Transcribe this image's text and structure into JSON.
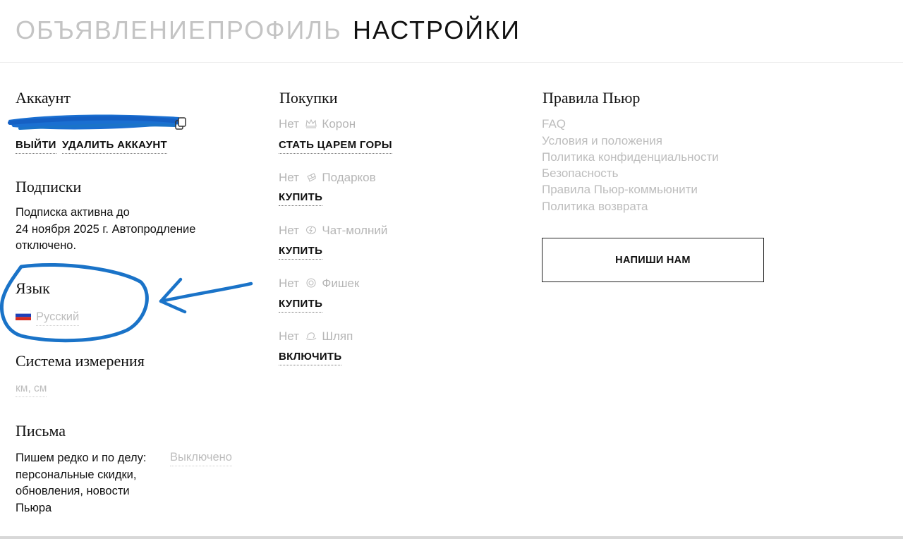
{
  "tabs": [
    {
      "label": "ОБЪЯВЛЕНИЕ",
      "active": false
    },
    {
      "label": "ПРОФИЛЬ",
      "active": false
    },
    {
      "label": "НАСТРОЙКИ",
      "active": true
    }
  ],
  "account": {
    "heading": "Аккаунт",
    "logout_label": "ВЫЙТИ",
    "delete_label": "УДАЛИТЬ АККАУНТ"
  },
  "subscriptions": {
    "heading": "Подписки",
    "status_lines": [
      "Подписка активна до",
      "24 ноября 2025 г. Автопродление",
      "отключено."
    ]
  },
  "language": {
    "heading": "Язык",
    "flag_icon": "russia-flag-icon",
    "value": "Русский"
  },
  "measurement": {
    "heading": "Система измерения",
    "value": "км, см"
  },
  "emails": {
    "heading": "Письма",
    "description_lines": [
      "Пишем редко и по делу:",
      "персональные скидки,",
      "обновления, новости",
      "Пьюра"
    ],
    "toggle_value": "Выключено"
  },
  "purchases": {
    "heading": "Покупки",
    "items": [
      {
        "prefix": "Нет",
        "icon": "crown-icon",
        "name": "Корон",
        "action": "СТАТЬ ЦАРЕМ ГОРЫ"
      },
      {
        "prefix": "Нет",
        "icon": "gift-icon",
        "name": "Подарков",
        "action": "КУПИТЬ"
      },
      {
        "prefix": "Нет",
        "icon": "lightning-chat-icon",
        "name": "Чат-молний",
        "action": "КУПИТЬ"
      },
      {
        "prefix": "Нет",
        "icon": "chip-icon",
        "name": "Фишек",
        "action": "КУПИТЬ"
      },
      {
        "prefix": "Нет",
        "icon": "hat-icon",
        "name": "Шляп",
        "action": "ВКЛЮЧИТЬ"
      }
    ]
  },
  "rules": {
    "heading": "Правила Пьюр",
    "links": [
      "FAQ",
      "Условия и положения",
      "Политика конфиденциальности",
      "Безопасность",
      "Правила Пьюр-коммьюнити",
      "Политика возврата"
    ],
    "contact_button": "НАПИШИ НАМ"
  },
  "colors": {
    "accent_annotation": "#1a73c8",
    "muted_text": "#bdbdbd",
    "primary_text": "#111111"
  }
}
